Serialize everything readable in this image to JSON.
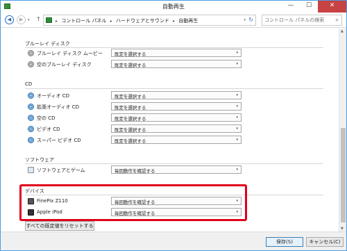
{
  "window": {
    "title": "自動再生",
    "minimize": "—",
    "maximize": "☐",
    "close": "✕"
  },
  "addressbar": {
    "back": "◀",
    "forward": "▶",
    "history": "▾",
    "up": "↑",
    "crumbs": [
      "コントロール パネル",
      "ハードウェアとサウンド",
      "自動再生"
    ],
    "crumb_sep": "▸",
    "dropdown": "▾",
    "refresh": "↻",
    "search_placeholder": "コントロール パネルの検索",
    "search_icon": "⌕"
  },
  "sections": {
    "bluray": {
      "heading": "ブルーレイ ディスク",
      "rows": [
        {
          "label": "ブルーレイ ディスク ムービー",
          "value": "既定を選択する",
          "icon": "disc-icon"
        },
        {
          "label": "空のブルーレイ ディスク",
          "value": "既定を選択する",
          "icon": "disc-icon"
        }
      ]
    },
    "cd": {
      "heading": "CD",
      "rows": [
        {
          "label": "オーディオ CD",
          "value": "既定を選択する",
          "icon": "cd-icon"
        },
        {
          "label": "拡張オーディオ CD",
          "value": "既定を選択する",
          "icon": "cd-icon"
        },
        {
          "label": "空の CD",
          "value": "既定を選択する",
          "icon": "cd-icon"
        },
        {
          "label": "ビデオ CD",
          "value": "既定を選択する",
          "icon": "cd-icon"
        },
        {
          "label": "スーパー ビデオ CD",
          "value": "既定を選択する",
          "icon": "cd-icon"
        }
      ]
    },
    "software": {
      "heading": "ソフトウェア",
      "rows": [
        {
          "label": "ソフトウェアとゲーム",
          "value": "毎回動作を確認する",
          "icon": "software-icon"
        }
      ]
    },
    "devices": {
      "heading": "デバイス",
      "rows": [
        {
          "label": "FinePix Z110",
          "value": "毎回動作を確認する",
          "icon": "camera-icon"
        },
        {
          "label": "Apple iPod",
          "value": "毎回動作を確認する",
          "icon": "ipod-icon"
        }
      ]
    }
  },
  "select_arrow": "▾",
  "reset_button": "すべての既定値をリセットする(R)",
  "footer": {
    "save": "保存(S)",
    "cancel": "キャンセル(C)"
  },
  "scrollbar": {
    "up": "▲",
    "down": "▼"
  },
  "colors": {
    "highlight_border": "#e0001b",
    "window_border": "#4a9de0",
    "close_button": "#c74242"
  }
}
